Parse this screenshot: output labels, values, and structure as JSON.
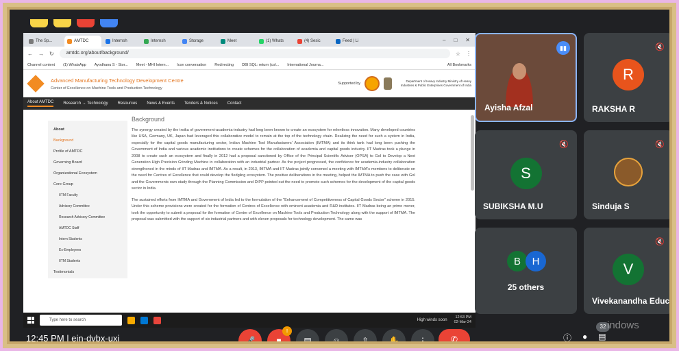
{
  "browser": {
    "tabs": [
      {
        "label": "The Sp...",
        "color": "#7a7a7a"
      },
      {
        "label": "AMTDC",
        "color": "#f28b22"
      },
      {
        "label": "Internsh",
        "color": "#1a73e8"
      },
      {
        "label": "Internsh",
        "color": "#34a853"
      },
      {
        "label": "Storage",
        "color": "#4285f4"
      },
      {
        "label": "Meet",
        "color": "#00897b"
      },
      {
        "label": "(1) Whats",
        "color": "#25d366"
      },
      {
        "label": "(4) Sesic",
        "color": "#ea4335"
      },
      {
        "label": "Feed | Li",
        "color": "#0a66c2"
      }
    ],
    "url": "amtdc.org/about/background/",
    "bookmarks": [
      "Channel content",
      "(1) WhatsApp",
      "Ayodhanu S - Stor...",
      "Meet - MHI Intern...",
      "Icon conversation",
      "Redirecting",
      "DBI SQL: return (col...",
      "International Journa..."
    ],
    "bookmarks_end": "All Bookmarks"
  },
  "site": {
    "title": "Advanced Manufacturing Technology Development Centre",
    "subtitle": "Center of Excellence on Machine Tools and Production Technology",
    "supported_by": "Supported by",
    "ministry": "Department of Heavy Industry Ministry of Heavy Industries & Public Enterprises Government of India",
    "nav": [
      "About AMTDC",
      "Research → Technology",
      "Resources",
      "News & Events",
      "Tenders & Notices",
      "Contact"
    ],
    "sidebar": {
      "heading": "About",
      "items": [
        "Background",
        "Profile of AMTDC",
        "Governing Board",
        "Organizational Ecosystem",
        "Core Group"
      ],
      "subitems": [
        "IITM Faculty",
        "Advisory Committee",
        "Research Advisory Committee",
        "AMTDC Staff",
        "Intern Students",
        "Ex-Employees",
        "IITM Students"
      ],
      "last": "Testimonials"
    },
    "article": {
      "heading": "Background",
      "p1": "The synergy created by the troika of government-academia-industry had long been known to create an ecosystem for relentless innovation. Many developed countries like USA, Germany, UK, Japan had leveraged this collaborative model to remain at the top of the technology chain. Realizing the need for such a system in India, especially for the capital goods manufacturing sector, Indian Machine Tool Manufacturers' Association (IMTMA) and its think tank had long been pushing the Government of India and various academic institutions to create schemes for the collaboration of academia and capital goods industry. IIT Madras took a plunge in 2008 to create such an ecosystem and finally in 2012 had a proposal sanctioned by Office of the Principal Scientific Adviser (OPSA) to GoI to Develop a Next Generation High Precision Grinding Machine in collaboration with an industrial partner. As the project progressed, the confidence for academia-industry collaboration strengthened in the minds of IIT Madras and IMTMA. As a result, in 2013, IMTMA and IIT Madras jointly convened a meeting with IMTMA's members to deliberate on the need for Centres of Excellence that could develop the fledgling ecosystem. The positive deliberations in the meeting, helped the IMTMA to push the case with GoI and the Governments own study through the Planning Commission and DIPP pointed out the need to promote such schemes for the development of the capital goods sector in India.",
      "p2": "The sustained efforts from IMTMA and Government of India led to the formulation of the \"Enhancement of Competitiveness of Capital Goods Sector\" scheme in 2015. Under this scheme provisions were created for the formation of Centres of Excellence with eminent academia and R&D institutes. IIT Madras being an prime mover, took the opportunity to submit a proposal for the formation of Centre of Excellence on Machine Tools and Production Technology along with the support of IMTMA. The proposal was submitted with the support of six industrial partners and with eleven proposals for technology development. The same was"
    }
  },
  "taskbar": {
    "search_placeholder": "Type here to search",
    "weather": "High winds soon",
    "time": "12:53 PM",
    "date": "02-Mar-24"
  },
  "participants": [
    {
      "name": "Ayisha Afzal",
      "initial": "",
      "color": "",
      "muted": false,
      "speaking": true
    },
    {
      "name": "RAKSHA R",
      "initial": "R",
      "color": "#e8541c",
      "muted": true
    },
    {
      "name": "SUBIKSHA M.U",
      "initial": "S",
      "color": "#137333",
      "muted": true
    },
    {
      "name": "Sinduja S",
      "initial": "",
      "color": "",
      "muted": true
    },
    {
      "name": "25 others",
      "initials": [
        "B",
        "H"
      ],
      "colors": [
        "#137333",
        "#1967d2"
      ]
    },
    {
      "name": "Vivekanandha Educa...",
      "initial": "V",
      "color": "#137333",
      "muted": true
    }
  ],
  "bottom": {
    "time": "12:45 PM",
    "meeting_code": "ein-dvbx-uxi",
    "participant_count": "32",
    "badge": "!",
    "watermark": "indows"
  },
  "colors": {
    "meet_bg": "#202124",
    "tile_bg": "#3c4043",
    "accent_orange": "#f28b22",
    "frame_gold": "#d9bf86",
    "pink_bg": "#e9b6e6"
  }
}
